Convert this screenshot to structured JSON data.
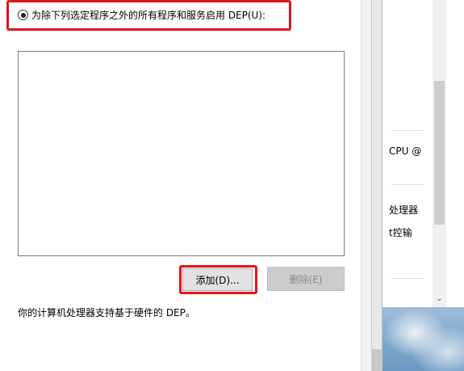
{
  "dep_dialog": {
    "radio_option_label": "为除下列选定程序之外的所有程序和服务启用 DEP(U):",
    "radio_selected": true,
    "program_list_items": [],
    "add_button_label": "添加(D)...",
    "remove_button_label": "删除(E)",
    "remove_button_enabled": false,
    "support_info": "你的计算机处理器支持基于硬件的 DEP。"
  },
  "background_window": {
    "text_lines": [
      "CPU @",
      "处理器",
      "t控输"
    ]
  },
  "annotations": {
    "highlight_color": "#e0141e"
  },
  "colors": {
    "button_face": "#e1e1e1",
    "disabled_button_face": "#cccccc",
    "disabled_text": "#8a8a8a"
  }
}
